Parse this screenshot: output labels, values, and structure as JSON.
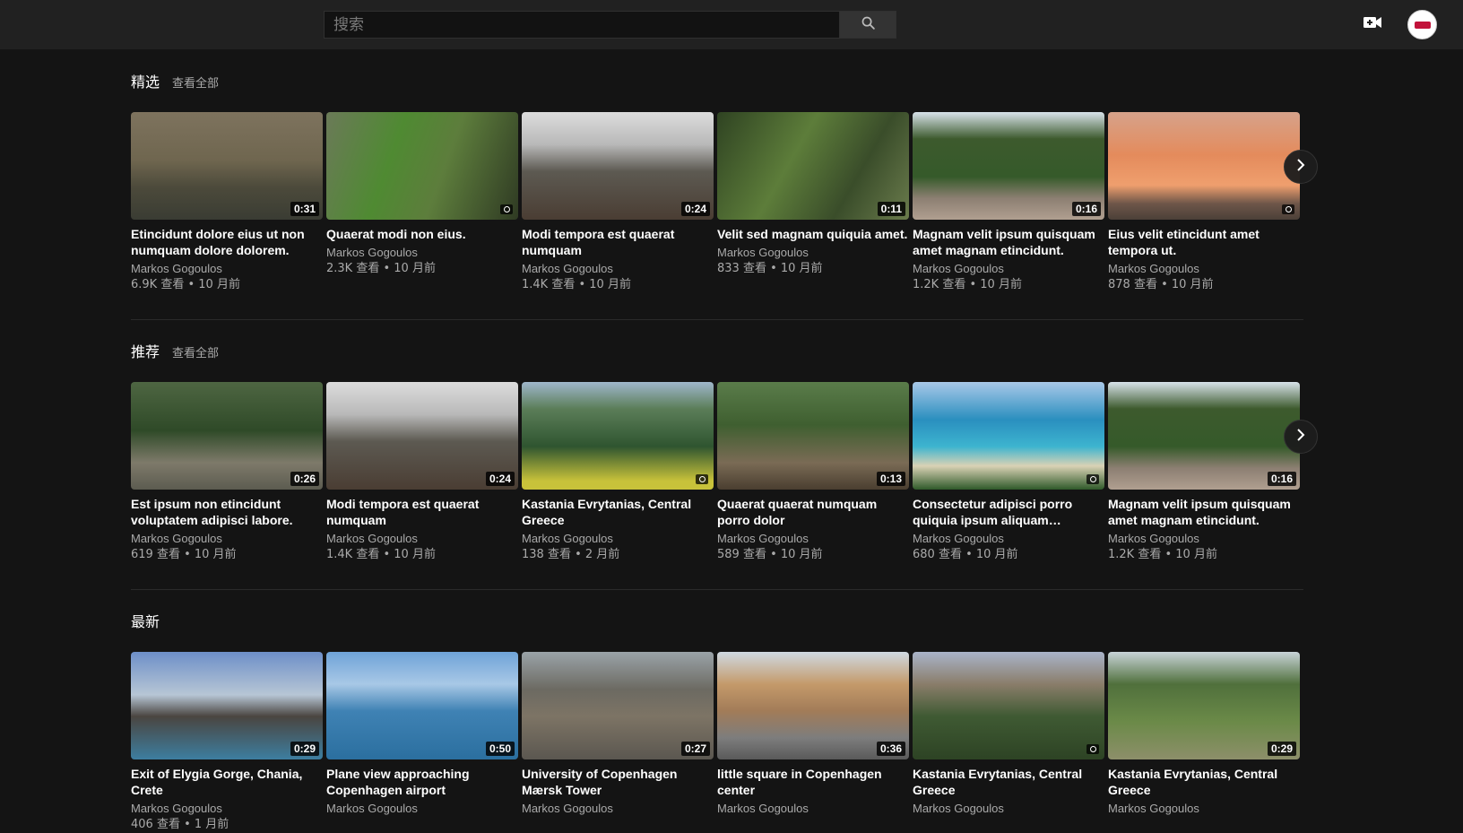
{
  "header": {
    "search_placeholder": "搜索"
  },
  "sections": [
    {
      "title": "精选",
      "view_all": "查看全部",
      "videos": [
        {
          "title": "Etincidunt dolore eius ut non numquam dolore dolorem.",
          "channel": "Markos Gogoulos",
          "meta": "6.9K 查看 • 10 月前",
          "duration": "0:31",
          "thumb": "reeds"
        },
        {
          "title": "Quaerat modi non eius.",
          "channel": "Markos Gogoulos",
          "meta": "2.3K 查看 • 10 月前",
          "duration": "",
          "thumb": "green"
        },
        {
          "title": "Modi tempora est quaerat numquam",
          "channel": "Markos Gogoulos",
          "meta": "1.4K 查看 • 10 月前",
          "duration": "0:24",
          "thumb": "mist"
        },
        {
          "title": "Velit sed magnam quiquia amet.",
          "channel": "Markos Gogoulos",
          "meta": "833 查看 • 10 月前",
          "duration": "0:11",
          "thumb": "blur"
        },
        {
          "title": "Magnam velit ipsum quisquam amet magnam etincidunt.",
          "channel": "Markos Gogoulos",
          "meta": "1.2K 查看 • 10 月前",
          "duration": "0:16",
          "thumb": "road"
        },
        {
          "title": "Eius velit etincidunt amet tempora ut.",
          "channel": "Markos Gogoulos",
          "meta": "878 查看 • 10 月前",
          "duration": "",
          "thumb": "sunset"
        }
      ]
    },
    {
      "title": "推荐",
      "view_all": "查看全部",
      "videos": [
        {
          "title": "Est ipsum non etincidunt voluptatem adipisci labore.",
          "channel": "Markos Gogoulos",
          "meta": "619 查看 • 10 月前",
          "duration": "0:26",
          "thumb": "forest"
        },
        {
          "title": "Modi tempora est quaerat numquam",
          "channel": "Markos Gogoulos",
          "meta": "1.4K 查看 • 10 月前",
          "duration": "0:24",
          "thumb": "mist"
        },
        {
          "title": "Kastania Evrytanias, Central Greece",
          "channel": "Markos Gogoulos",
          "meta": "138 查看 • 2 月前",
          "duration": "",
          "thumb": "valley"
        },
        {
          "title": "Quaerat quaerat numquam porro dolor",
          "channel": "Markos Gogoulos",
          "meta": "589 查看 • 10 月前",
          "duration": "0:13",
          "thumb": "trail"
        },
        {
          "title": "Consectetur adipisci porro quiquia ipsum aliquam etincidun...",
          "channel": "Markos Gogoulos",
          "meta": "680 查看 • 10 月前",
          "duration": "",
          "thumb": "beach"
        },
        {
          "title": "Magnam velit ipsum quisquam amet magnam etincidunt.",
          "channel": "Markos Gogoulos",
          "meta": "1.2K 查看 • 10 月前",
          "duration": "0:16",
          "thumb": "road"
        }
      ]
    },
    {
      "title": "最新",
      "view_all": "",
      "videos": [
        {
          "title": "Exit of Elygia Gorge, Chania, Crete",
          "channel": "Markos Gogoulos",
          "meta": "406 查看 • 1 月前",
          "duration": "0:29",
          "thumb": "rocks"
        },
        {
          "title": "Plane view approaching Copenhagen airport",
          "channel": "Markos Gogoulos",
          "meta": "",
          "duration": "0:50",
          "thumb": "plane"
        },
        {
          "title": "University of Copenhagen Mærsk Tower",
          "channel": "Markos Gogoulos",
          "meta": "",
          "duration": "0:27",
          "thumb": "city"
        },
        {
          "title": "little square in Copenhagen center",
          "channel": "Markos Gogoulos",
          "meta": "",
          "duration": "0:36",
          "thumb": "square"
        },
        {
          "title": "Kastania Evrytanias, Central Greece",
          "channel": "Markos Gogoulos",
          "meta": "",
          "duration": "",
          "thumb": "mount"
        },
        {
          "title": "Kastania Evrytanias, Central Greece",
          "channel": "Markos Gogoulos",
          "meta": "",
          "duration": "0:29",
          "thumb": "meadow"
        }
      ]
    }
  ],
  "icons": {
    "search": "search-icon",
    "upload": "video-upload-icon",
    "next": "chevron-right-icon",
    "photo": "camera-icon"
  }
}
